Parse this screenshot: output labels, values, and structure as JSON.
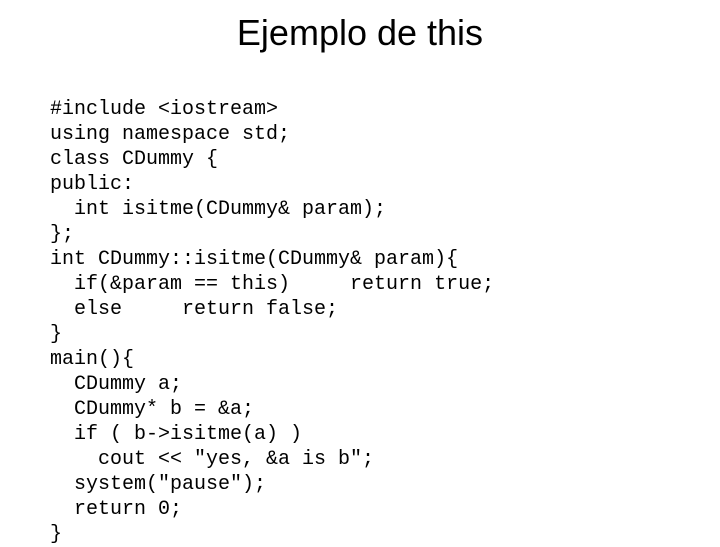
{
  "title": "Ejemplo de this",
  "code": {
    "l01": "#include <iostream>",
    "l02": "using namespace std;",
    "l03": "class CDummy {",
    "l04": "public:",
    "l05": "  int isitme(CDummy& param);",
    "l06": "};",
    "l07": "int CDummy::isitme(CDummy& param){",
    "l08": "  if(&param == this)     return true;",
    "l09": "  else     return false;",
    "l10": "}",
    "l11": "main(){",
    "l12": "  CDummy a;",
    "l13": "  CDummy* b = &a;",
    "l14": "  if ( b->isitme(a) )",
    "l15": "    cout << \"yes, &a is b\";",
    "l16": "  system(\"pause\");",
    "l17": "  return 0;",
    "l18": "}"
  }
}
